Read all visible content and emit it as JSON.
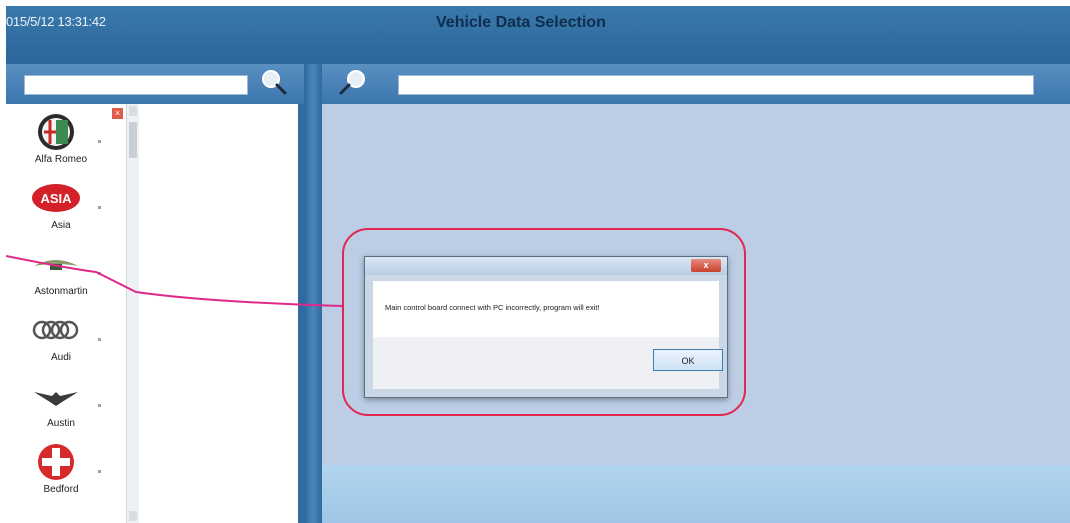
{
  "window": {
    "datetime": "015/5/12 13:31:42",
    "title": "Vehicle Data Selection"
  },
  "left_search": {
    "placeholder": ""
  },
  "right_search": {
    "placeholder": ""
  },
  "brands": [
    {
      "label": "Alfa Romeo",
      "icon": "alfa-romeo-logo"
    },
    {
      "label": "Asia",
      "icon": "asia-logo",
      "logo_text": "ASIA"
    },
    {
      "label": "Astonmartin",
      "icon": "aston-martin-logo"
    },
    {
      "label": "Audi",
      "icon": "audi-logo"
    },
    {
      "label": "Austin",
      "icon": "austin-logo"
    },
    {
      "label": "Bedford",
      "icon": "bedford-logo"
    }
  ],
  "dialog": {
    "close_label": "x",
    "message": "Main control board connect with PC incorrectly, program will exit!",
    "ok_label": "OK"
  },
  "colors": {
    "highlight": "#e0284f",
    "frame": "#2f6b9f",
    "pane": "#bccde5"
  }
}
